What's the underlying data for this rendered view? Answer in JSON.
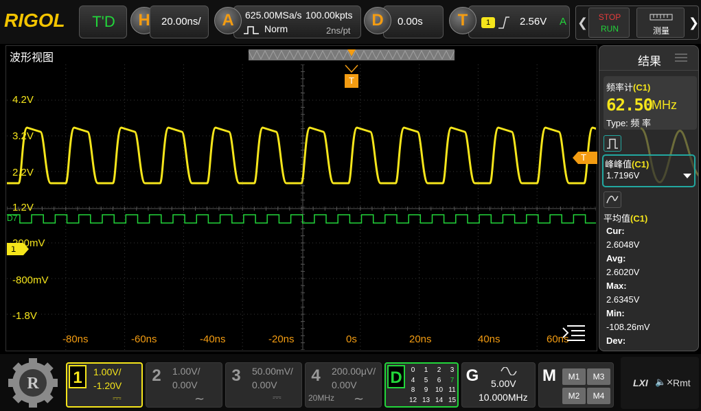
{
  "topbar": {
    "logo": "RIGOL",
    "mode": "T'D",
    "horizontal": {
      "letter": "H",
      "timebase": "20.00ns/"
    },
    "acquire": {
      "letter": "A",
      "sample_rate": "625.00MSa/s",
      "mode": "Norm",
      "memory": "100.00kpts",
      "time_per_pt": "2ns/pt"
    },
    "delay": {
      "letter": "D",
      "value": "0.00s"
    },
    "trigger": {
      "letter": "T",
      "source": "1",
      "level": "2.56V",
      "mode": "A"
    },
    "stop_run": {
      "stop": "STOP",
      "run": "RUN"
    },
    "measure_label": "测量"
  },
  "wave": {
    "title": "波形视图",
    "trigger_marker": "T",
    "trigger_level_marker": "T",
    "channel1_marker": "1",
    "d7_label": "D7",
    "y_labels": [
      "4.2V",
      "3.2V",
      "2.2V",
      "1.2V",
      "200mV",
      "-800mV",
      "-1.8V"
    ],
    "x_labels": [
      "-80ns",
      "-60ns",
      "-40ns",
      "-20ns",
      "0s",
      "20ns",
      "40ns",
      "60ns"
    ]
  },
  "results": {
    "title": "结果",
    "freq_counter_label": "频率计",
    "freq_counter_ch": "(C1)",
    "freq_value": "62.50",
    "freq_unit": "MHz",
    "freq_type": "Type:  频 率",
    "vpp_label": "峰峰值",
    "vpp_ch": "(C1)",
    "vpp_value": "1.7196V",
    "avg_label": "平均值",
    "avg_ch": "(C1)",
    "cur_label": "Cur:",
    "cur_value": "2.6048V",
    "avg_stat_label": "Avg:",
    "avg_stat_value": "2.6020V",
    "max_label": "Max:",
    "max_value": "2.6345V",
    "min_label": "Min:",
    "min_value": "-108.26mV",
    "dev_label": "Dev:"
  },
  "bottombar": {
    "ch1": {
      "num": "1",
      "scale": "1.00V/",
      "offset": "-1.20V",
      "coupling": "⎓"
    },
    "ch2": {
      "num": "2",
      "scale": "1.00V/",
      "offset": "0.00V",
      "coupling": "∼"
    },
    "ch3": {
      "num": "3",
      "scale": "50.00mV/",
      "offset": "0.00V",
      "coupling": "⎓"
    },
    "ch4": {
      "num": "4",
      "scale": "200.00μV/",
      "offset": "0.00V",
      "bw": "20MHz",
      "coupling": "∼"
    },
    "digital": {
      "letter": "D",
      "channels": [
        "0",
        "1",
        "2",
        "3",
        "4",
        "5",
        "6",
        "7",
        "8",
        "9",
        "10",
        "11",
        "12",
        "13",
        "14",
        "15"
      ]
    },
    "generator": {
      "letter": "G",
      "amplitude": "5.00V",
      "frequency": "10.000MHz"
    },
    "math": {
      "letter": "M",
      "buttons": [
        "M1",
        "M3",
        "M2",
        "M4"
      ]
    },
    "status": {
      "lxi": "LXI",
      "sound": "🔈×",
      "remote": "Rmt"
    }
  },
  "colors": {
    "ch1": "#f5e51b",
    "digital": "#22d63a",
    "trigger": "#f39c12",
    "grid": "#3a3a3a",
    "freq": "#f5e51b"
  }
}
